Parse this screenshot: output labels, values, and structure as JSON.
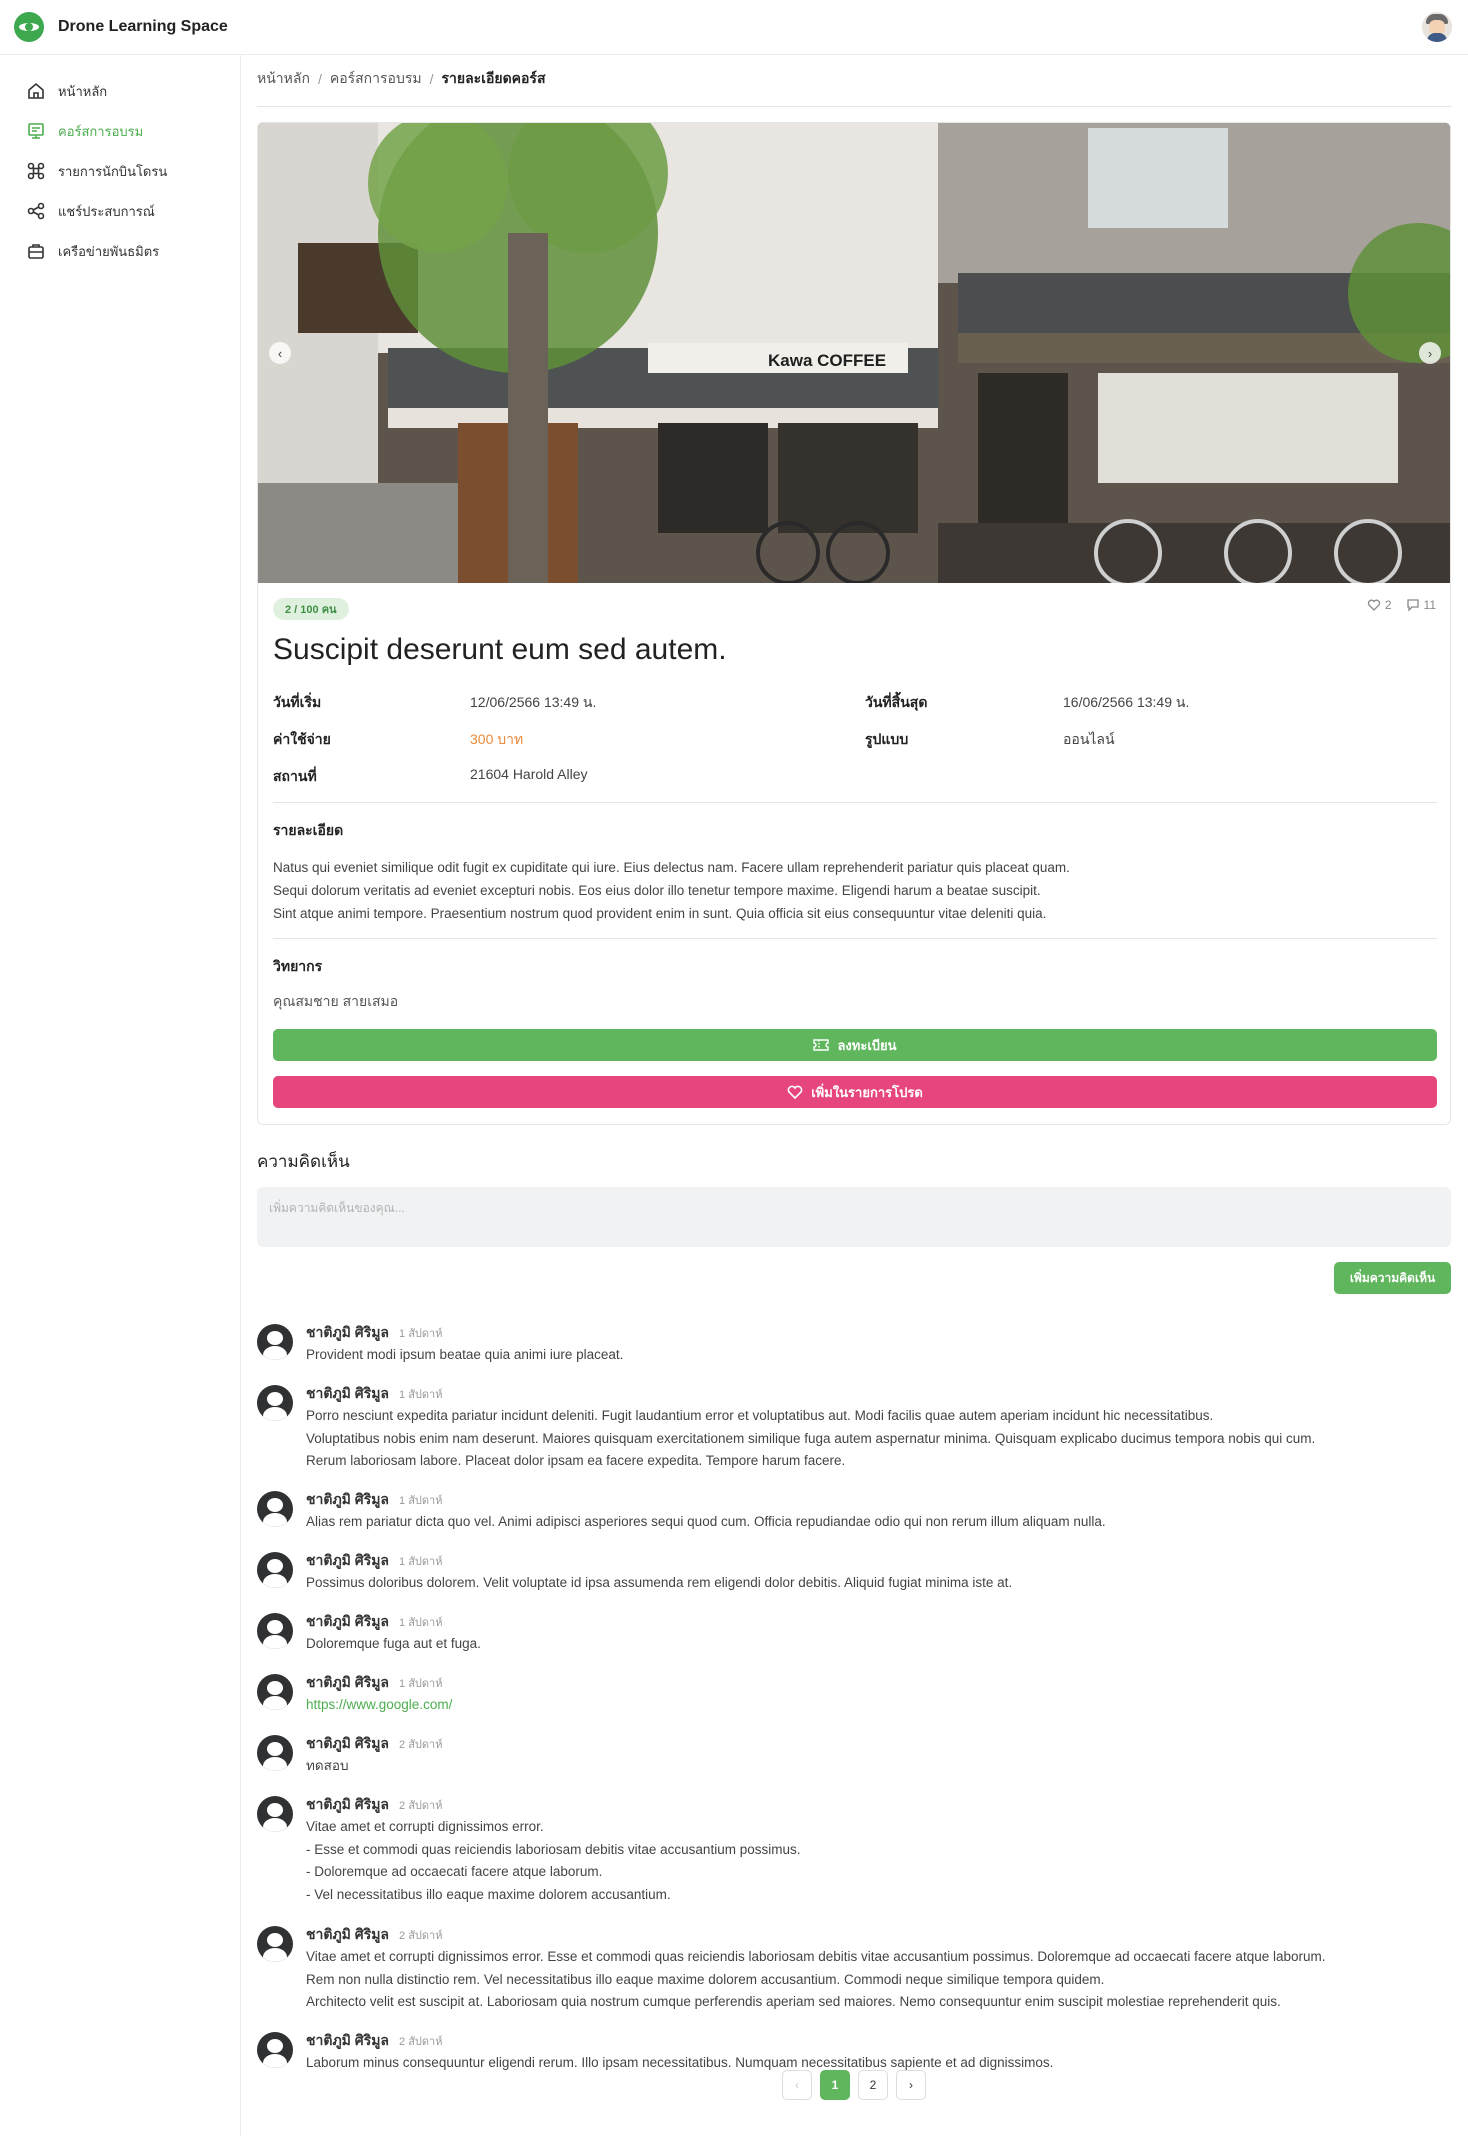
{
  "app": {
    "title": "Drone Learning Space"
  },
  "sidebar": {
    "items": [
      {
        "label": "หน้าหลัก",
        "icon": "home-icon"
      },
      {
        "label": "คอร์สการอบรม",
        "icon": "course-icon",
        "active": true
      },
      {
        "label": "รายการนักบินโดรน",
        "icon": "drone-icon"
      },
      {
        "label": "แชร์ประสบการณ์",
        "icon": "share-icon"
      },
      {
        "label": "เครือข่ายพันธมิตร",
        "icon": "briefcase-icon"
      }
    ]
  },
  "breadcrumb": {
    "home": "หน้าหลัก",
    "section": "คอร์สการอบรม",
    "current": "รายละเอียดคอร์ส"
  },
  "course": {
    "seats": "2 / 100 คน",
    "likes": "2",
    "comments": "11",
    "title": "Suscipit deserunt eum sed autem.",
    "start_label": "วันที่เริ่ม",
    "start_value": "12/06/2566 13:49 น.",
    "end_label": "วันที่สิ้นสุด",
    "end_value": "16/06/2566 13:49 น.",
    "cost_label": "ค่าใช้จ่าย",
    "cost_value": "300 บาท",
    "format_label": "รูปแบบ",
    "format_value": "ออนไลน์",
    "location_label": "สถานที่",
    "location_value": "21604 Harold Alley",
    "detail_title": "รายละเอียด",
    "detail_lines": [
      "Natus qui eveniet similique odit fugit ex cupiditate qui iure. Eius delectus nam. Facere ullam reprehenderit pariatur quis placeat quam.",
      "Sequi dolorum veritatis ad eveniet excepturi nobis. Eos eius dolor illo tenetur tempore maxime. Eligendi harum a beatae suscipit.",
      "Sint atque animi tempore. Praesentium nostrum quod provident enim in sunt. Quia officia sit eius consequuntur vitae deleniti quia."
    ],
    "instructor_title": "วิทยากร",
    "instructor_name": "คุณสมชาย สายเสมอ",
    "register_label": "ลงทะเบียน",
    "favorite_label": "เพิ่มในรายการโปรด"
  },
  "comments_section": {
    "title": "ความคิดเห็น",
    "placeholder": "เพิ่มความคิดเห็นของคุณ...",
    "submit_label": "เพิ่มความคิดเห็น",
    "items": [
      {
        "name": "ชาติภูมิ ศิริมูล",
        "time": "1 สัปดาห์",
        "lines": [
          "Provident modi ipsum beatae quia animi iure placeat."
        ]
      },
      {
        "name": "ชาติภูมิ ศิริมูล",
        "time": "1 สัปดาห์",
        "lines": [
          "Porro nesciunt expedita pariatur incidunt deleniti. Fugit laudantium error et voluptatibus aut. Modi facilis quae autem aperiam incidunt hic necessitatibus.",
          "Voluptatibus nobis enim nam deserunt. Maiores quisquam exercitationem similique fuga autem aspernatur minima. Quisquam explicabo ducimus tempora nobis qui cum.",
          "Rerum laboriosam labore. Placeat dolor ipsam ea facere expedita. Tempore harum facere."
        ]
      },
      {
        "name": "ชาติภูมิ ศิริมูล",
        "time": "1 สัปดาห์",
        "lines": [
          "Alias rem pariatur dicta quo vel. Animi adipisci asperiores sequi quod cum. Officia repudiandae odio qui non rerum illum aliquam nulla."
        ]
      },
      {
        "name": "ชาติภูมิ ศิริมูล",
        "time": "1 สัปดาห์",
        "lines": [
          "Possimus doloribus dolorem. Velit voluptate id ipsa assumenda rem eligendi dolor debitis. Aliquid fugiat minima iste at."
        ]
      },
      {
        "name": "ชาติภูมิ ศิริมูล",
        "time": "1 สัปดาห์",
        "lines": [
          "Doloremque fuga aut et fuga."
        ]
      },
      {
        "name": "ชาติภูมิ ศิริมูล",
        "time": "1 สัปดาห์",
        "link": "https://www.google.com/"
      },
      {
        "name": "ชาติภูมิ ศิริมูล",
        "time": "2 สัปดาห์",
        "lines": [
          "ทดสอบ"
        ]
      },
      {
        "name": "ชาติภูมิ ศิริมูล",
        "time": "2 สัปดาห์",
        "lines": [
          "Vitae amet et corrupti dignissimos error.",
          "- Esse et commodi quas reiciendis laboriosam debitis vitae accusantium possimus.",
          "- Doloremque ad occaecati facere atque laborum.",
          "- Vel necessitatibus illo eaque maxime dolorem accusantium."
        ]
      },
      {
        "name": "ชาติภูมิ ศิริมูล",
        "time": "2 สัปดาห์",
        "lines": [
          "Vitae amet et corrupti dignissimos error. Esse et commodi quas reiciendis laboriosam debitis vitae accusantium possimus. Doloremque ad occaecati facere atque laborum.",
          "Rem non nulla distinctio rem. Vel necessitatibus illo eaque maxime dolorem accusantium. Commodi neque similique tempora quidem.",
          "Architecto velit est suscipit at. Laboriosam quia nostrum cumque perferendis aperiam sed maiores. Nemo consequuntur enim suscipit molestiae reprehenderit quis."
        ]
      },
      {
        "name": "ชาติภูมิ ศิริมูล",
        "time": "2 สัปดาห์",
        "lines": [
          "Laborum minus consequuntur eligendi rerum. Illo ipsam necessitatibus. Numquam necessitatibus sapiente et ad dignissimos."
        ]
      }
    ]
  },
  "hero": {
    "sign_text": "Kawa COFFEE"
  },
  "pagination": {
    "prev": "‹",
    "pages": [
      "1",
      "2"
    ],
    "current": "1",
    "next": "›"
  },
  "colors": {
    "accent": "#5fb65c",
    "pink": "#e6457d",
    "price": "#e98a3a"
  }
}
